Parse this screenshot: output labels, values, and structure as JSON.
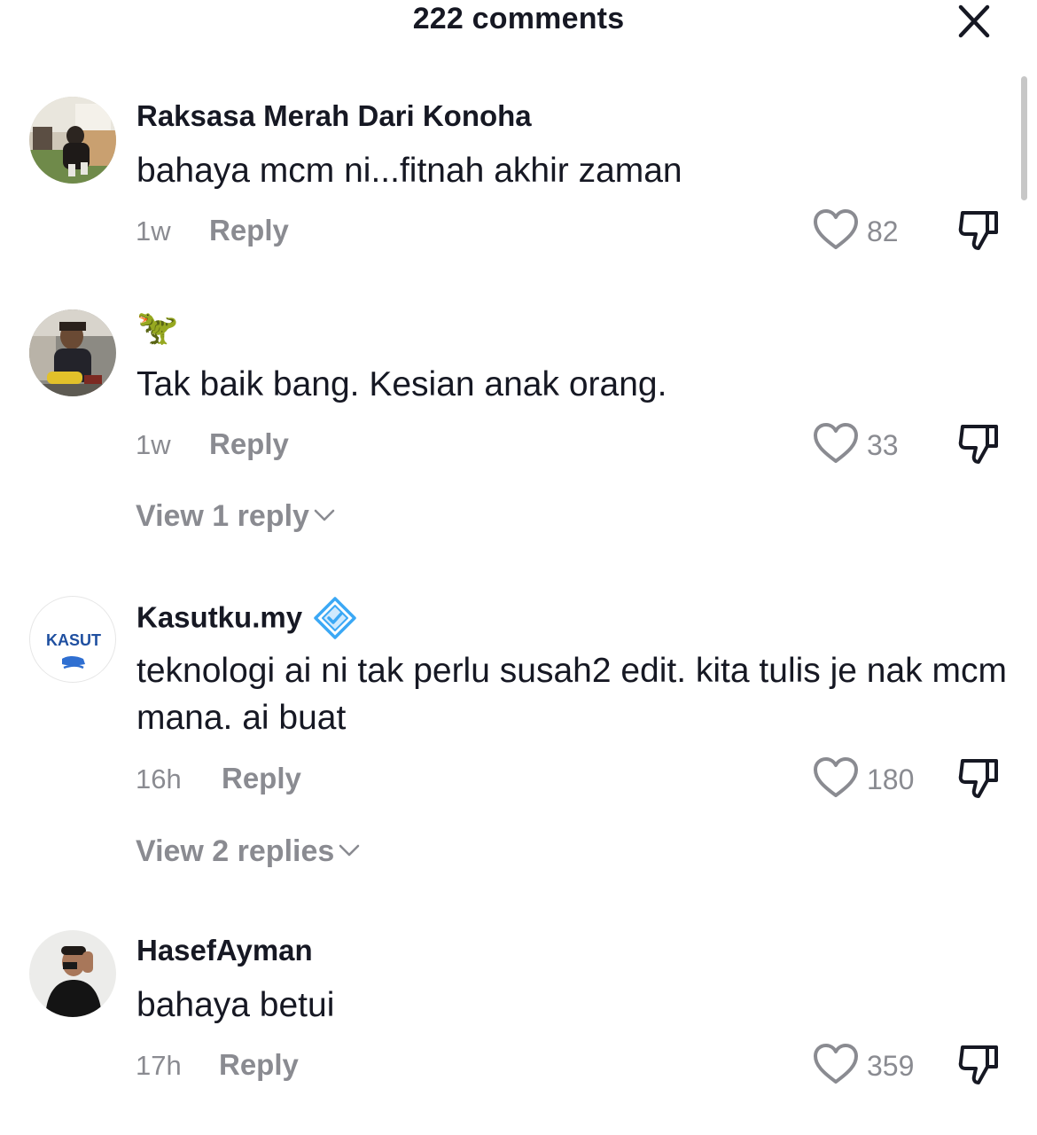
{
  "header": {
    "title": "222 comments",
    "close_icon": "close-icon"
  },
  "comments": [
    {
      "username": "Raksasa Merah Dari Konoha",
      "text": "bahaya mcm ni...fitnah akhir zaman",
      "time": "1w",
      "reply_label": "Reply",
      "likes": "82"
    },
    {
      "username": "🦖",
      "text": "Tak baik bang. Kesian anak orang.",
      "time": "1w",
      "reply_label": "Reply",
      "likes": "33",
      "view_replies": "View 1 reply"
    },
    {
      "username": "Kasutku.my",
      "verified": true,
      "avatar_text": "KASUT",
      "text": "teknologi ai ni tak perlu susah2 edit. kita tulis je nak mcm mana. ai buat",
      "time": "16h",
      "reply_label": "Reply",
      "likes": "180",
      "view_replies": "View 2 replies"
    },
    {
      "username": "HasefAyman",
      "text": "bahaya betui",
      "time": "17h",
      "reply_label": "Reply",
      "likes": "359"
    }
  ],
  "colors": {
    "primary_text": "#161823",
    "secondary_text": "#8a8b91",
    "verified_badge": "#3ba8f5"
  }
}
